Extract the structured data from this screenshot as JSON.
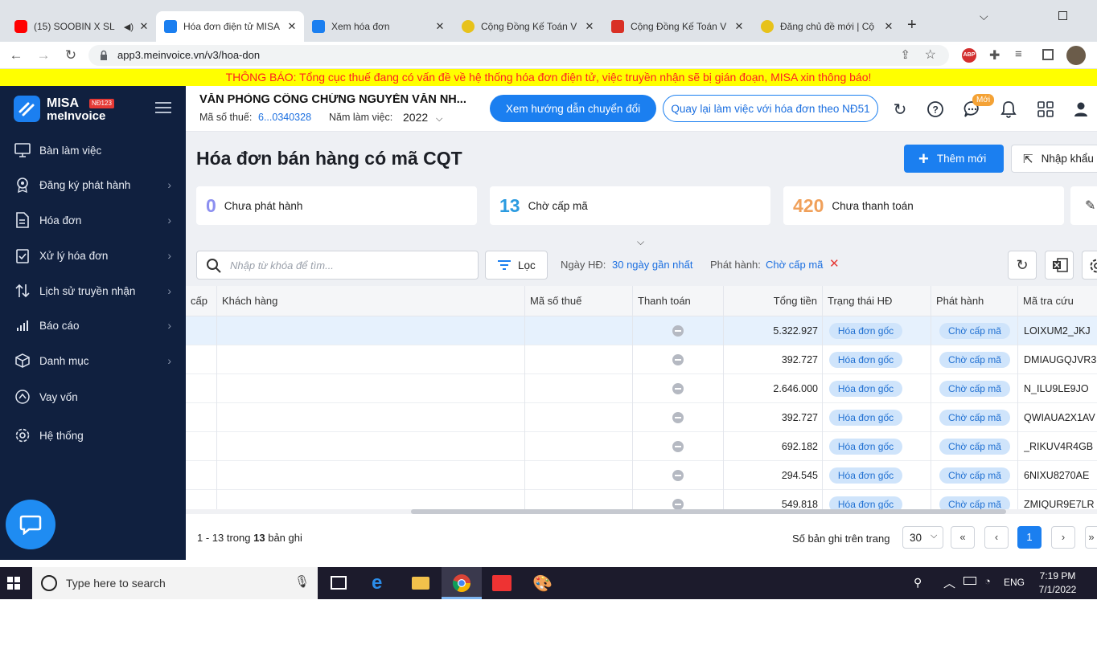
{
  "browser": {
    "tabs": [
      {
        "title": "(15) SOOBIN X SL",
        "icon": "youtube-icon",
        "color": "#ff0000"
      },
      {
        "title": "Hóa đơn điện tử MISA",
        "icon": "misa-icon",
        "color": "#1b7ff0"
      },
      {
        "title": "Xem hóa đơn",
        "icon": "misa-icon",
        "color": "#1b7ff0"
      },
      {
        "title": "Cộng Đồng Kế Toán V",
        "icon": "community-icon",
        "color": "#e7c21a"
      },
      {
        "title": "Cộng Đồng Kế Toán V",
        "icon": "gmail-icon",
        "color": "#d93025"
      },
      {
        "title": "Đăng chủ đề mới | Cộ",
        "icon": "community-icon",
        "color": "#e7c21a"
      }
    ],
    "url": "app3.meinvoice.vn/v3/hoa-don"
  },
  "notice": "THÔNG BÁO: Tổng cục thuế đang có vấn đề về hệ thống hóa đơn điện tử, việc truyền nhận sẽ bị gián đoạn, MISA xin thông báo!",
  "brand": {
    "name": "MISA",
    "sub": "meInvoice",
    "badge": "NĐ123"
  },
  "sidebar": {
    "items": [
      {
        "label": "Bàn làm việc",
        "icon": "desktop-icon",
        "chevron": false
      },
      {
        "label": "Đăng ký phát hành",
        "icon": "register-icon",
        "chevron": true
      },
      {
        "label": "Hóa đơn",
        "icon": "invoice-icon",
        "chevron": true
      },
      {
        "label": "Xử lý hóa đơn",
        "icon": "process-icon",
        "chevron": true
      },
      {
        "label": "Lịch sử truyền nhận",
        "icon": "history-icon",
        "chevron": true
      },
      {
        "label": "Báo cáo",
        "icon": "report-icon",
        "chevron": true
      },
      {
        "label": "Danh mục",
        "icon": "category-icon",
        "chevron": true
      },
      {
        "label": "Vay vốn",
        "icon": "loan-icon",
        "chevron": false
      },
      {
        "label": "Hệ thống",
        "icon": "settings-icon",
        "chevron": false
      }
    ]
  },
  "header": {
    "company": "VĂN PHÒNG CÔNG CHỨNG NGUYỄN VĂN NH...",
    "tax_label": "Mã số thuế:",
    "tax_value": "6...0340328",
    "year_label": "Năm làm việc:",
    "year": "2022",
    "guide_btn": "Xem hướng dẫn chuyển đổi",
    "back_btn": "Quay lại làm việc với hóa đơn theo NĐ51",
    "new_badge": "Mới"
  },
  "page": {
    "title": "Hóa đơn bán hàng có mã CQT",
    "add_btn": "Thêm mới",
    "import_btn": "Nhập khẩu"
  },
  "stats": [
    {
      "num": "0",
      "label": "Chưa phát hành",
      "color": "#8c8ff0"
    },
    {
      "num": "13",
      "label": "Chờ cấp mã",
      "color": "#2b9be0"
    },
    {
      "num": "420",
      "label": "Chưa thanh toán",
      "color": "#f0a05a"
    }
  ],
  "filter": {
    "search_placeholder": "Nhập từ khóa để tìm...",
    "filter_btn": "Lọc",
    "date_label": "Ngày HĐ:",
    "date_value": "30 ngày gần nhất",
    "issue_label": "Phát hành:",
    "issue_value": "Chờ cấp mã"
  },
  "table": {
    "headers": [
      "cấp",
      "Khách hàng",
      "Mã số thuế",
      "Thanh toán",
      "Tổng tiền",
      "Trạng thái HĐ",
      "Phát hành",
      "Mã tra cứu"
    ],
    "rows": [
      {
        "total": "5.322.927",
        "status": "Hóa đơn gốc",
        "issue": "Chờ cấp mã",
        "code": "LOIXUM2_JKJ"
      },
      {
        "total": "392.727",
        "status": "Hóa đơn gốc",
        "issue": "Chờ cấp mã",
        "code": "DMIAUGQJVR3"
      },
      {
        "total": "2.646.000",
        "status": "Hóa đơn gốc",
        "issue": "Chờ cấp mã",
        "code": "N_ILU9LE9JO"
      },
      {
        "total": "392.727",
        "status": "Hóa đơn gốc",
        "issue": "Chờ cấp mã",
        "code": "QWIAUA2X1AV"
      },
      {
        "total": "692.182",
        "status": "Hóa đơn gốc",
        "issue": "Chờ cấp mã",
        "code": "_RIKUV4R4GB"
      },
      {
        "total": "294.545",
        "status": "Hóa đơn gốc",
        "issue": "Chờ cấp mã",
        "code": "6NIXU8270AE"
      },
      {
        "total": "549.818",
        "status": "Hóa đơn gốc",
        "issue": "Chờ cấp mã",
        "code": "ZMIQUR9E7LR"
      }
    ]
  },
  "pager": {
    "summary_pre": "1 - 13 trong",
    "summary_num": "13",
    "summary_post": "bản ghi",
    "per_page_label": "Số bản ghi trên trang",
    "per_page": "30",
    "current": "1"
  },
  "taskbar": {
    "search_placeholder": "Type here to search",
    "lang": "ENG",
    "time": "7:19 PM",
    "date": "7/1/2022"
  }
}
